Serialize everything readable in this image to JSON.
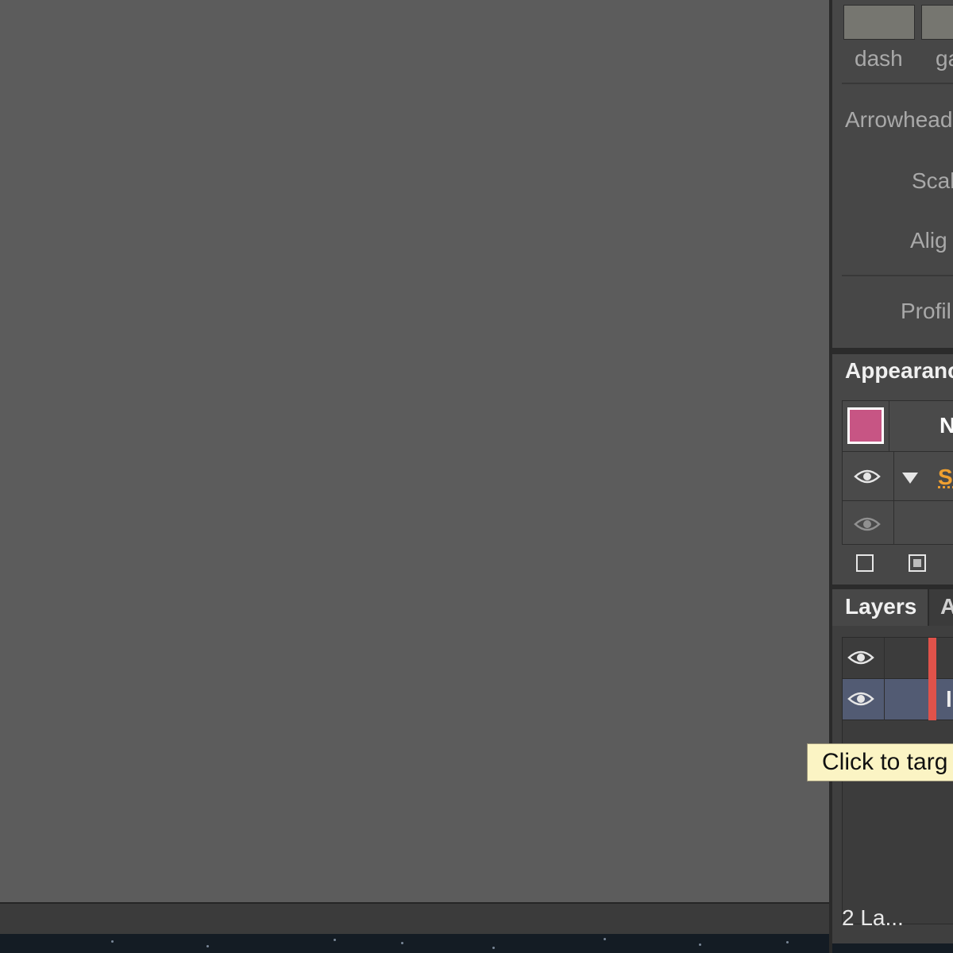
{
  "stroke": {
    "dash_label": "dash",
    "gap_label": "ga",
    "arrowheads_label": "Arrowhead",
    "scale_label": "Scal",
    "align_label": "Alig",
    "profile_label": "Profil"
  },
  "appearance": {
    "title": "Appearanc",
    "rows": [
      {
        "label": "N",
        "label_color": "#ffffff",
        "fill_color": "#c75584"
      },
      {
        "label": "St",
        "label_color": "#f0a030"
      },
      {
        "label": ""
      }
    ]
  },
  "layers": {
    "tab_label": "Layers",
    "other_tab_label": "A",
    "rows": [
      {
        "name": "",
        "selected": false,
        "color": "#e0524a"
      },
      {
        "name": "l",
        "selected": true,
        "color": "#e0524a"
      }
    ],
    "footer": "2 La..."
  },
  "tooltip": {
    "text": "Click to targ"
  }
}
